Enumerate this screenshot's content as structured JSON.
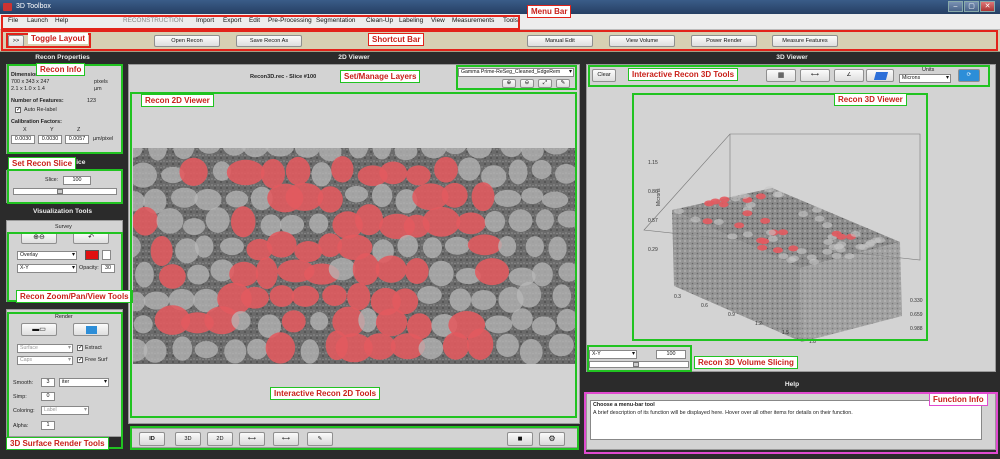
{
  "window": {
    "title": "3D Toolbox",
    "controls": [
      "–",
      "▢",
      "✕"
    ]
  },
  "menu": [
    "File",
    "Launch",
    "Help",
    "RECONSTRUCTION",
    "Import",
    "Export",
    "Edit",
    "Pre-Processing",
    "Segmentation",
    "Clean-Up",
    "Labeling",
    "View",
    "Measurements",
    "Tools"
  ],
  "shortcut": {
    "toggle": ">>",
    "open": "Open Recon",
    "save": "Save Recon As",
    "manual": "Manual Edit",
    "view": "View Volume",
    "render": "Power Render",
    "measure": "Measure Features"
  },
  "left": {
    "recon_props": "Recon Properties",
    "dimensions_label": "Dimensions:",
    "dim_px": "700  x  343  x  247",
    "dim_px_unit": "pixels",
    "dim_um": "2.1  x  1.0  x  1.4",
    "dim_um_unit": "µm",
    "features_label": "Number of Features:",
    "features_value": "123",
    "auto_relabel": "Auto Re-label",
    "calib_label": "Calibration Factors:",
    "axes": [
      "X",
      "Y",
      "Z"
    ],
    "calib_values": [
      "0.0030",
      "0.0030",
      "0.0057"
    ],
    "calib_unit": "µm/pixel",
    "slice_title": "Set Recon Slice",
    "slice_label": "Slice:",
    "slice_value": "100",
    "slice_fraction": 0.45,
    "vis_title": "Visualization Tools",
    "survey": "Survey",
    "overlay": "Overlay",
    "plane": "X-Y",
    "opacity_label": "Opacity:",
    "opacity_value": "30",
    "render": "Render",
    "surface": "Surface",
    "extract": "Extract",
    "caps": "Caps",
    "free_surf": "Free Surf",
    "smooth_label": "Smooth:",
    "smooth_value": "3",
    "smooth_unit": "iter",
    "simp_label": "Simp:",
    "simp_value": "0",
    "coloring_label": "Coloring:",
    "coloring_value": "Label",
    "alpha_label": "Alpha:",
    "alpha_value": "1"
  },
  "center": {
    "title": "2D Viewer",
    "slice_caption": "Recon3D.rec - Slice #100",
    "layer": "Gamma Prime-ReSeg_Cleaned_EdgeRem",
    "tools": [
      "ID",
      "3D",
      "2D",
      "⟷",
      "⟷",
      "✎",
      "",
      "⚙"
    ]
  },
  "right": {
    "title": "3D Viewer",
    "clear": "Clear",
    "units_label": "Units",
    "units_value": "Microns",
    "zlabel": "Microns",
    "zticks": [
      "1.15",
      "0.86",
      "0.57",
      "0.29"
    ],
    "xticks": [
      "0.3",
      "0.6",
      "0.9",
      "1.2",
      "1.5",
      "1.8",
      "2.1"
    ],
    "yticks": [
      "0.988",
      "0.659",
      "0.330"
    ],
    "plane": "X-Y",
    "slice_value": "100",
    "slice_fraction": 0.47,
    "help_title": "Help",
    "help_heading": "Choose a menu-bar tool",
    "help_text": "A brief description of its function will be displayed here. Hover over all other items for details on their function."
  },
  "annotations": {
    "menu_bar": "Menu Bar",
    "toggle_layout": "Toggle Layout",
    "shortcut_bar": "Shortcut Bar",
    "recon_info": "Recon Info",
    "set_slice": "Set Recon Slice",
    "zoom_tools": "Recon Zoom/Pan/View Tools",
    "render_tools": "3D Surface Render Tools",
    "set_layers": "Set/Manage Layers",
    "viewer_2d": "Recon 2D Viewer",
    "tools_2d": "Interactive Recon 2D Tools",
    "tools_3d": "Interactive Recon 3D Tools",
    "viewer_3d": "Recon 3D Viewer",
    "volume_slicing": "Recon 3D Volume Slicing",
    "function_info": "Function Info"
  },
  "colors": {
    "accent_green": "#21c321",
    "accent_red": "#e2231a",
    "feature": "#e35a5f",
    "help_border": "#e04bd0"
  }
}
